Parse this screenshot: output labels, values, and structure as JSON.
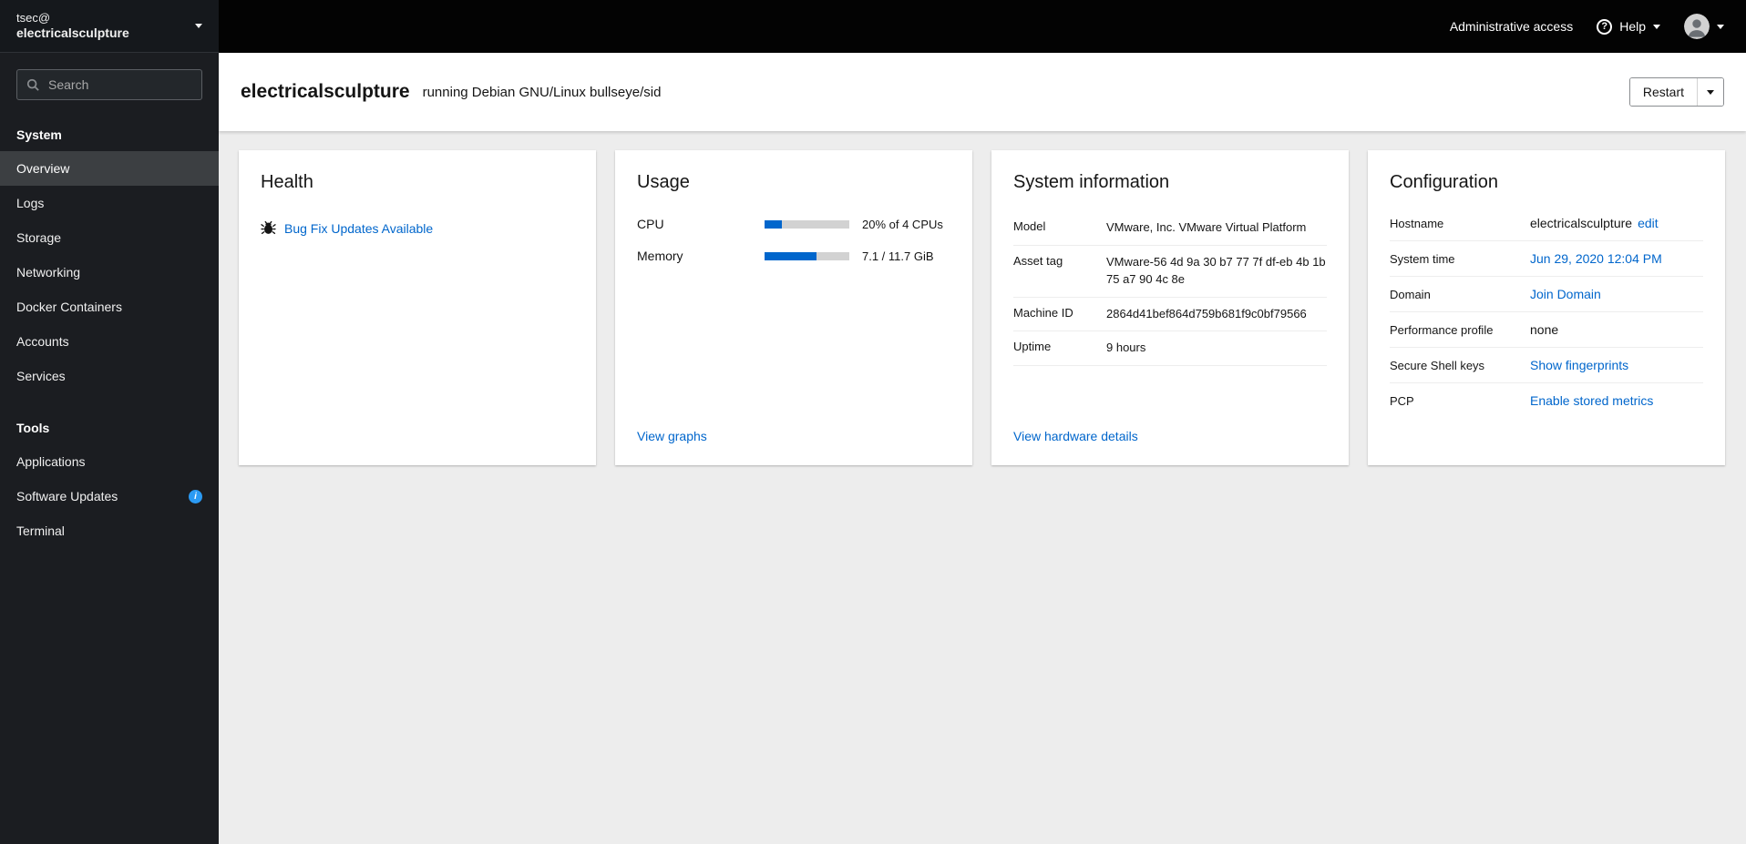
{
  "colors": {
    "link": "#0066cc",
    "progress_fill": "#0066cc",
    "progress_track": "#d2d2d2",
    "info_icon": "#2b9af3",
    "masthead_bg": "#030303",
    "sidebar_bg": "#1b1d21",
    "active_nav_bg": "#3c3f42"
  },
  "topbar": {
    "admin_access_label": "Administrative access",
    "help_label": "Help"
  },
  "sidebar": {
    "user_prefix": "tsec@",
    "hostname": "electricalsculpture",
    "search_placeholder": "Search",
    "sections": [
      {
        "title": "System",
        "items": [
          {
            "label": "Overview"
          },
          {
            "label": "Logs"
          },
          {
            "label": "Storage"
          },
          {
            "label": "Networking"
          },
          {
            "label": "Docker Containers"
          },
          {
            "label": "Accounts"
          },
          {
            "label": "Services"
          }
        ]
      },
      {
        "title": "Tools",
        "items": [
          {
            "label": "Applications"
          },
          {
            "label": "Software Updates"
          },
          {
            "label": "Terminal"
          }
        ]
      }
    ]
  },
  "header": {
    "hostname": "electricalsculpture",
    "subtitle": "running Debian GNU/Linux bullseye/sid",
    "restart_label": "Restart"
  },
  "health": {
    "title": "Health",
    "updates_link": "Bug Fix Updates Available"
  },
  "usage": {
    "title": "Usage",
    "rows": [
      {
        "label": "CPU",
        "value": "20% of 4 CPUs",
        "percent": 20
      },
      {
        "label": "Memory",
        "value": "7.1 / 11.7 GiB",
        "percent": 61
      }
    ],
    "view_graphs_link": "View graphs"
  },
  "system_information": {
    "title": "System information",
    "rows": [
      {
        "label": "Model",
        "value": "VMware, Inc. VMware Virtual Platform"
      },
      {
        "label": "Asset tag",
        "value": "VMware-56 4d 9a 30 b7 77 7f df-eb 4b 1b 75 a7 90 4c 8e"
      },
      {
        "label": "Machine ID",
        "value": "2864d41bef864d759b681f9c0bf79566"
      },
      {
        "label": "Uptime",
        "value": "9 hours"
      }
    ],
    "hardware_link": "View hardware details"
  },
  "configuration": {
    "title": "Configuration",
    "rows": [
      {
        "label": "Hostname",
        "value": "electricalsculpture",
        "link": "edit"
      },
      {
        "label": "System time",
        "link": "Jun 29, 2020 12:04 PM"
      },
      {
        "label": "Domain",
        "link": "Join Domain"
      },
      {
        "label": "Performance profile",
        "value": "none"
      },
      {
        "label": "Secure Shell keys",
        "link": "Show fingerprints"
      },
      {
        "label": "PCP",
        "link": "Enable stored metrics"
      }
    ]
  }
}
